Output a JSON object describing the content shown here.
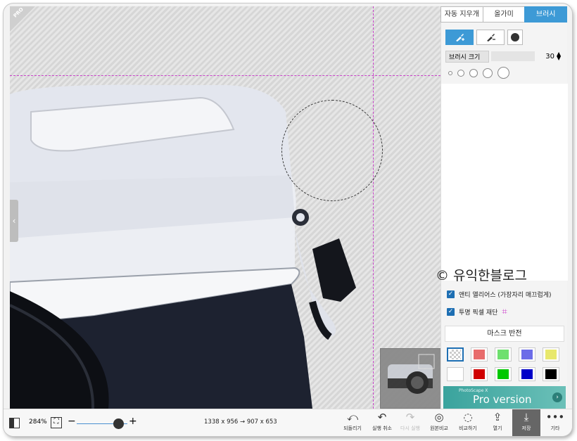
{
  "corner_badge": "PRO",
  "tabs": [
    {
      "label": "자동 지우개",
      "active": false
    },
    {
      "label": "올가미",
      "active": false
    },
    {
      "label": "브러시",
      "active": true
    }
  ],
  "brush": {
    "size_label": "브러시 크기",
    "size_value": "30"
  },
  "options": {
    "antialias_label": "앤티 앨리어스 (가장자리 매끄럽게)",
    "antialias_checked": true,
    "transparent_label": "투명 픽셀 재단",
    "transparent_checked": true
  },
  "mask_invert_label": "마스크 반전",
  "swatch_colors": [
    "checker",
    "#e86c6c",
    "#6ee06e",
    "#6c6ce8",
    "#e8e86c",
    "#ffffff",
    "#d00000",
    "#00c800",
    "#0000c8",
    "#000000"
  ],
  "pro_banner": {
    "small": "PhotoScape X",
    "label": "Pro version"
  },
  "watermark": "© 유익한블로그",
  "bottom": {
    "zoom": "284%",
    "dimensions": "1338 x 956 → 907 x 653",
    "revert": "되돌리기",
    "undo": "실행 취소",
    "redo": "다시 실행",
    "compare_original": "원본비교",
    "compare": "비교하기",
    "open": "열기",
    "save": "저장",
    "more": "기타"
  }
}
